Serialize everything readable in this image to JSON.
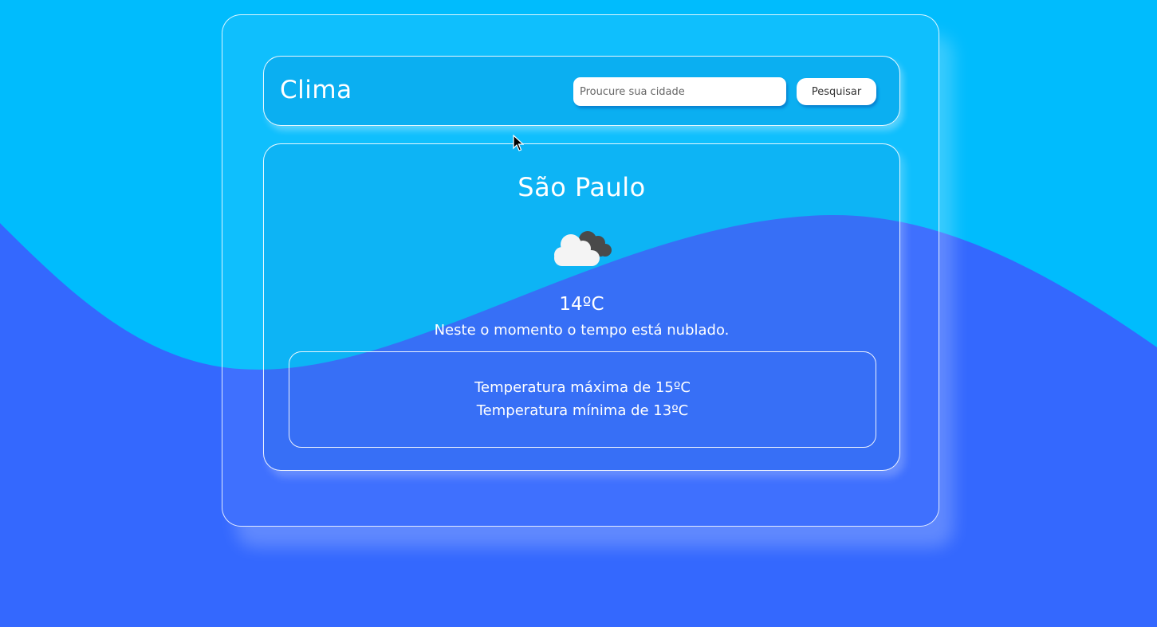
{
  "header": {
    "title": "Clima",
    "search_placeholder": "Proucure sua cidade",
    "search_button_label": "Pesquisar"
  },
  "weather": {
    "city": "São Paulo",
    "icon": "cloudy-icon",
    "temperature": "14ºC",
    "description": "Neste o momento o tempo está nublado.",
    "max_label": "Temperatura máxima de 15ºC",
    "min_label": "Temperatura mínima de 13ºC"
  },
  "colors": {
    "background_top": "#00bcfd",
    "background_bottom": "#3468fe",
    "text": "#ffffff"
  }
}
